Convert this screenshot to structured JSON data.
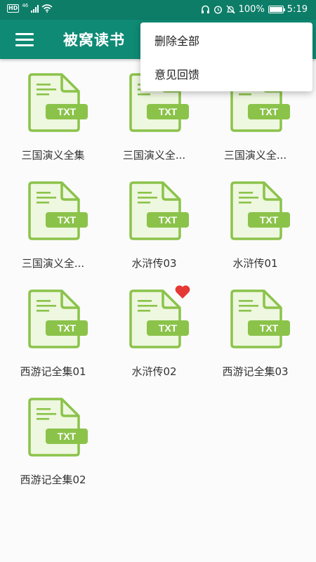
{
  "status_bar": {
    "network": "HD",
    "signal_type": "46",
    "battery_text": "100%",
    "battery_level": 1.0,
    "time": "5:19",
    "icons": [
      "hd-icon",
      "signal-icon",
      "wifi-icon",
      "headphone-icon",
      "alarm-icon",
      "mute-icon",
      "battery-icon"
    ]
  },
  "app_bar": {
    "title": "被窝读书",
    "menu_icon": "hamburger-menu-icon"
  },
  "popup_menu": {
    "items": [
      "删除全部",
      "意见回馈"
    ]
  },
  "files": [
    {
      "name": "三国演义全集",
      "type": "TXT",
      "favorite": false
    },
    {
      "name": "三国演义全...",
      "type": "TXT",
      "favorite": false
    },
    {
      "name": "三国演义全...",
      "type": "TXT",
      "favorite": false
    },
    {
      "name": "三国演义全...",
      "type": "TXT",
      "favorite": false
    },
    {
      "name": "水浒传03",
      "type": "TXT",
      "favorite": false
    },
    {
      "name": "水浒传01",
      "type": "TXT",
      "favorite": false
    },
    {
      "name": "西游记全集01",
      "type": "TXT",
      "favorite": false
    },
    {
      "name": "水浒传02",
      "type": "TXT",
      "favorite": true
    },
    {
      "name": "西游记全集03",
      "type": "TXT",
      "favorite": false
    },
    {
      "name": "西游记全集02",
      "type": "TXT",
      "favorite": false
    }
  ],
  "colors": {
    "status_bar": "#0d7d68",
    "app_bar": "#0f8a74",
    "icon_green": "#8bc34a",
    "icon_fill": "#eef7df",
    "heart": "#e53935"
  }
}
